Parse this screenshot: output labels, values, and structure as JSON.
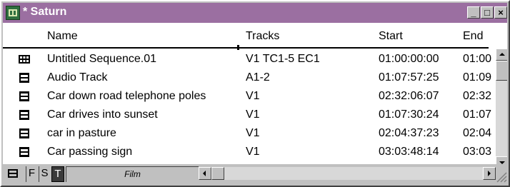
{
  "window": {
    "title": "* Saturn",
    "title_bar_color": "#9b6fa1",
    "buttons": {
      "minimize": "_",
      "maximize": "□",
      "close": "×"
    }
  },
  "columns": {
    "name": "Name",
    "tracks": "Tracks",
    "start": "Start",
    "end": "End"
  },
  "rows": [
    {
      "icon": "sequence-icon",
      "name": "Untitled Sequence.01",
      "tracks": "V1 TC1-5 EC1",
      "start": "01:00:00:00",
      "end": "01:00"
    },
    {
      "icon": "clip-icon",
      "name": "Audio Track",
      "tracks": "A1-2",
      "start": "01:07:57:25",
      "end": "01:09"
    },
    {
      "icon": "clip-icon",
      "name": "Car down road telephone poles",
      "tracks": "V1",
      "start": "02:32:06:07",
      "end": "02:32"
    },
    {
      "icon": "clip-icon",
      "name": "Car drives into sunset",
      "tracks": "V1",
      "start": "01:07:30:24",
      "end": "01:07"
    },
    {
      "icon": "clip-icon",
      "name": "car in pasture",
      "tracks": "V1",
      "start": "02:04:37:23",
      "end": "02:04"
    },
    {
      "icon": "clip-icon",
      "name": "Car passing sign",
      "tracks": "V1",
      "start": "03:03:48:14",
      "end": "03:03"
    }
  ],
  "toolbar": {
    "f_label": "F",
    "s_label": "S",
    "t_label": "T",
    "view_label": "Film"
  }
}
